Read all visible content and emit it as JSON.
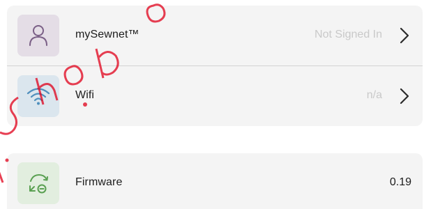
{
  "settings": {
    "account": {
      "label": "mySewnet™",
      "status": "Not Signed In",
      "icon": "user-icon"
    },
    "wifi": {
      "label": "Wifi",
      "status": "n/a",
      "icon": "wifi-icon"
    },
    "firmware": {
      "label": "Firmware",
      "value": "0.19",
      "icon": "firmware-update-icon"
    }
  },
  "colors": {
    "card_background": "#f4f4f4",
    "account_icon_bg": "#e4dde6",
    "account_icon_fg": "#7a5f86",
    "wifi_icon_bg": "#dbe6ee",
    "wifi_icon_fg": "#4f8fbd",
    "firmware_icon_bg": "#e2eedf",
    "firmware_icon_fg": "#5aa052",
    "status_text": "#c9c9c9",
    "watermark": "#e0001a"
  }
}
